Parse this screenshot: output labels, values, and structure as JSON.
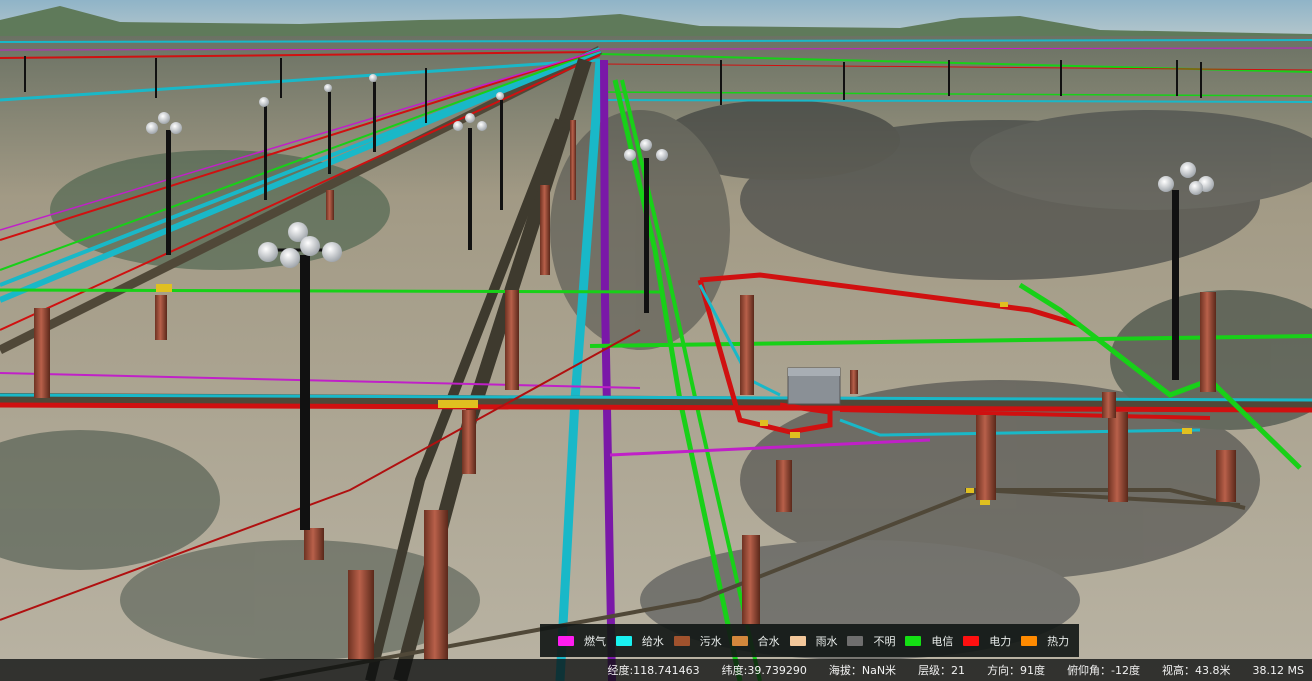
{
  "legend": {
    "items": [
      {
        "label": "燃气",
        "color": "#ff1df0"
      },
      {
        "label": "给水",
        "color": "#19f0f0"
      },
      {
        "label": "污水",
        "color": "#a0522d"
      },
      {
        "label": "合水",
        "color": "#d2873c"
      },
      {
        "label": "雨水",
        "color": "#f2c79a"
      },
      {
        "label": "不明",
        "color": "#6e6e6e"
      },
      {
        "label": "电信",
        "color": "#14e014"
      },
      {
        "label": "电力",
        "color": "#ff1010"
      },
      {
        "label": "热力",
        "color": "#ff8a00"
      }
    ]
  },
  "status": {
    "longitude": "经度:118.741463",
    "latitude": "纬度:39.739290",
    "altitude": "海拔：NaN米",
    "level": "层级：21",
    "heading": "方向：91度",
    "pitch": "俯仰角：-12度",
    "camera_height": "视高：43.8米",
    "frame_time": "38.12 MS"
  },
  "pipe_colors": {
    "gas": "#c020c8",
    "water": "#19b8c8",
    "power": "#d01010",
    "telecom": "#18d018",
    "unknown": "#504838",
    "drain": "#6a3a1a"
  }
}
